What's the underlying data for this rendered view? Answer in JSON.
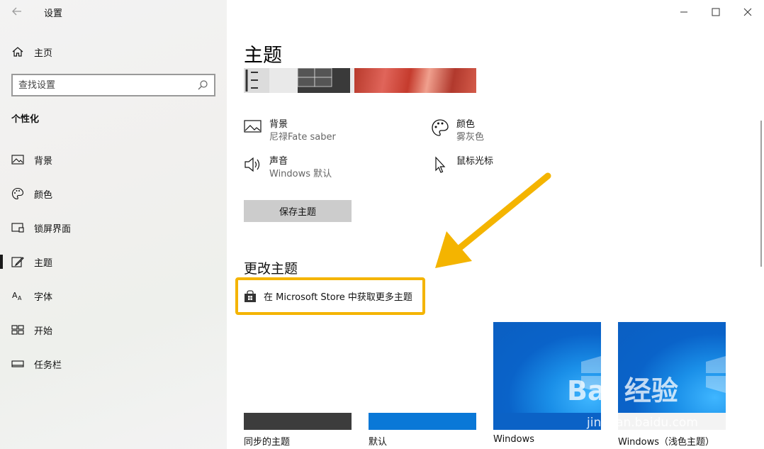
{
  "window": {
    "app_title": "设置",
    "controls": {
      "minimize": "—",
      "maximize": "☐",
      "close": "✕"
    }
  },
  "sidebar": {
    "home_label": "主页",
    "search_placeholder": "查找设置",
    "section_title": "个性化",
    "items": [
      {
        "label": "背景",
        "icon": "background-icon"
      },
      {
        "label": "颜色",
        "icon": "palette-icon"
      },
      {
        "label": "锁屏界面",
        "icon": "lock-screen-icon"
      },
      {
        "label": "主题",
        "icon": "theme-icon",
        "active": true
      },
      {
        "label": "字体",
        "icon": "font-icon"
      },
      {
        "label": "开始",
        "icon": "start-icon"
      },
      {
        "label": "任务栏",
        "icon": "taskbar-icon"
      }
    ]
  },
  "main": {
    "title": "主题",
    "attributes": {
      "background": {
        "name": "背景",
        "value": "尼禄Fate saber"
      },
      "color": {
        "name": "颜色",
        "value": "雾灰色"
      },
      "sound": {
        "name": "声音",
        "value": "Windows 默认"
      },
      "cursor": {
        "name": "鼠标光标",
        "value": ""
      }
    },
    "save_button": "保存主题",
    "change_theme_heading": "更改主题",
    "store_link": "在 Microsoft Store 中获取更多主题",
    "themes": [
      {
        "label": "同步的主题",
        "color": "#3c3c3c"
      },
      {
        "label": "默认",
        "color": "#0a78d7"
      },
      {
        "label": "Windows",
        "color": "#1a8fe8"
      },
      {
        "label": "Windows（浅色主题）",
        "color": "#1a8fe8"
      }
    ]
  },
  "watermark": {
    "brand": "Bai 经验",
    "url": "jingyan.baidu.com"
  },
  "colors": {
    "highlight": "#f4b400",
    "accent": "#0a78d7"
  }
}
